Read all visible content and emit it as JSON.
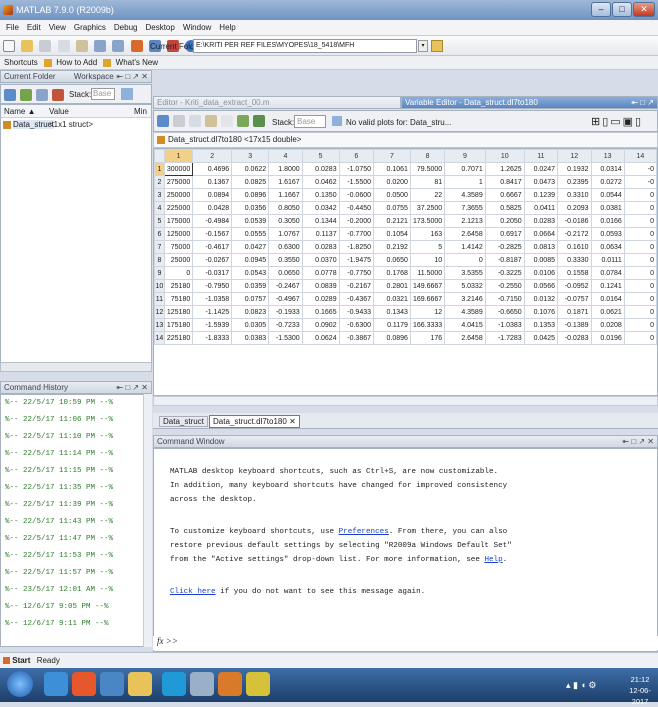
{
  "window": {
    "title": "MATLAB 7.9.0 (R2009b)",
    "min": "–",
    "max": "□",
    "close": "✕"
  },
  "menu": [
    "File",
    "Edit",
    "View",
    "Graphics",
    "Debug",
    "Desktop",
    "Window",
    "Help"
  ],
  "toolbar": {
    "current_folder_label": "Current Folder:",
    "current_folder_value": "E:\\KRITI PER REF FILES\\MYOPES\\18_5418\\MFH"
  },
  "shortcuts": {
    "shortcuts": "Shortcuts",
    "howto": "How to Add",
    "whatsnew": "What's New"
  },
  "current_folder": {
    "tab1": "Current Folder",
    "tab2": "Workspace",
    "stack_label": "Stack:",
    "stack_value": "Base",
    "col_name": "Name ▲",
    "col_value": "Value",
    "col_min": "Min",
    "var_name": "Data_struct",
    "var_value": "<1x1 struct>"
  },
  "command_history": {
    "title": "Command History",
    "entries": [
      "%-- 22/5/17 10:59 PM --%",
      "%-- 22/5/17 11:06 PM --%",
      "%-- 22/5/17 11:10 PM --%",
      "%-- 22/5/17 11:14 PM --%",
      "%-- 22/5/17 11:15 PM --%",
      "%-- 22/5/17 11:35 PM --%",
      "%-- 22/5/17 11:39 PM --%",
      "%-- 22/5/17 11:43 PM --%",
      "%-- 22/5/17 11:47 PM --%",
      "%-- 22/5/17 11:53 PM --%",
      "%-- 22/5/17 11:57 PM --%",
      "%-- 23/5/17 12:01 AM --%",
      "%-- 12/6/17  9:05 PM --%",
      "%-- 12/6/17  9:11 PM --%"
    ]
  },
  "editor_tab": {
    "title": "Editor - Kriti_data_extract_00.m"
  },
  "variable_editor": {
    "title": "Variable Editor - Data_struct.dl7to180",
    "stack_label": "Stack:",
    "stack_value": "Base",
    "plot_label": "No valid plots for: Data_stru...",
    "var_label": "Data_struct.dl7to180 <17x15 double>",
    "cols": [
      "1",
      "2",
      "3",
      "4",
      "5",
      "6",
      "7",
      "8",
      "9",
      "10",
      "11",
      "12",
      "13",
      "14"
    ],
    "rows": [
      [
        "300000",
        "0.4696",
        "0.0622",
        "1.8000",
        "0.0283",
        "-1.0750",
        "0.1061",
        "79.5000",
        "0.7071",
        "1.2625",
        "0.0247",
        "0.1932",
        "0.0314",
        "-0"
      ],
      [
        "275000",
        "0.1367",
        "0.0825",
        "1.6167",
        "0.0462",
        "-1.5500",
        "0.0200",
        "81",
        "1",
        "0.8417",
        "0.0473",
        "0.2395",
        "0.0272",
        "-0"
      ],
      [
        "250000",
        "0.0894",
        "0.0896",
        "1.1667",
        "0.1350",
        "-0.0600",
        "0.0500",
        "22",
        "4.3589",
        "0.6667",
        "0.1239",
        "0.3310",
        "0.0544",
        "0"
      ],
      [
        "225000",
        "0.0428",
        "0.0356",
        "0.8050",
        "0.0342",
        "-0.4450",
        "0.0755",
        "37.2500",
        "7.3655",
        "0.5825",
        "0.0411",
        "0.2093",
        "0.0381",
        "0"
      ],
      [
        "175000",
        "-0.4984",
        "0.0539",
        "0.3050",
        "0.1344",
        "-0.2000",
        "0.2121",
        "173.5000",
        "2.1213",
        "0.2050",
        "0.0283",
        "-0.0186",
        "0.0166",
        "0"
      ],
      [
        "125000",
        "-0.1567",
        "0.0555",
        "1.0767",
        "0.1137",
        "-0.7700",
        "0.1054",
        "163",
        "2.6458",
        "0.6917",
        "0.0664",
        "-0.2172",
        "0.0593",
        "0"
      ],
      [
        "75000",
        "-0.4617",
        "0.0427",
        "0.6300",
        "0.0283",
        "-1.8250",
        "0.2192",
        "5",
        "1.4142",
        "-0.2825",
        "0.0813",
        "0.1610",
        "0.0634",
        "0"
      ],
      [
        "25000",
        "-0.0267",
        "0.0945",
        "0.3550",
        "0.0370",
        "-1.9475",
        "0.0650",
        "10",
        "0",
        "-0.8187",
        "0.0085",
        "0.3330",
        "0.0111",
        "0"
      ],
      [
        "0",
        "-0.0317",
        "0.0543",
        "0.0650",
        "0.0778",
        "-0.7750",
        "0.1768",
        "11.5000",
        "3.5355",
        "-0.3225",
        "0.0106",
        "0.1558",
        "0.0784",
        "0"
      ],
      [
        "25180",
        "-0.7950",
        "0.0359",
        "-0.2467",
        "0.0839",
        "-0.2167",
        "0.2801",
        "149.6667",
        "5.0332",
        "-0.2550",
        "0.0566",
        "-0.0952",
        "0.1241",
        "0"
      ],
      [
        "75180",
        "-1.0358",
        "0.0757",
        "-0.4967",
        "0.0289",
        "-0.4367",
        "0.0321",
        "169.6667",
        "3.2146",
        "-0.7150",
        "0.0132",
        "-0.0757",
        "0.0164",
        "0"
      ],
      [
        "125180",
        "-1.1425",
        "0.0823",
        "-0.1933",
        "0.1665",
        "-0.9433",
        "0.1343",
        "12",
        "4.3589",
        "-0.6650",
        "0.1076",
        "0.1871",
        "0.0621",
        "0"
      ],
      [
        "175180",
        "-1.5939",
        "0.0305",
        "-0.7233",
        "0.0902",
        "-0.6300",
        "0.1179",
        "166.3333",
        "4.0415",
        "-1.0383",
        "0.1353",
        "-0.1389",
        "0.0208",
        "0"
      ],
      [
        "225180",
        "-1.8333",
        "0.0383",
        "-1.5300",
        "0.0624",
        "-0.3867",
        "0.0896",
        "176",
        "2.6458",
        "-1.7283",
        "0.0425",
        "-0.0283",
        "0.0196",
        "0"
      ]
    ],
    "tab1": "Data_struct",
    "tab2": "Data_struct.dl7to180"
  },
  "command_window": {
    "title": "Command Window",
    "line1": "MATLAB desktop keyboard shortcuts, such as Ctrl+S, are now customizable.",
    "line2": "In addition, many keyboard shortcuts have changed for improved consistency",
    "line3": "across the desktop.",
    "line4a": "To customize keyboard shortcuts, use ",
    "link_pref": "Preferences",
    "line4b": ". From there, you can also",
    "line5": "restore previous default settings by selecting \"R2009a Windows Default Set\"",
    "line6a": "from the \"Active settings\" drop-down list. For more information, see ",
    "link_help": "Help",
    "line6b": ".",
    "link_click": "Click here",
    "line7": " if you do not want to see this message again.",
    "prompt": "fx >>"
  },
  "status": {
    "start": "Start",
    "ready": "Ready"
  },
  "taskbar": {
    "time": "21:12",
    "date": "12-06-2017"
  }
}
